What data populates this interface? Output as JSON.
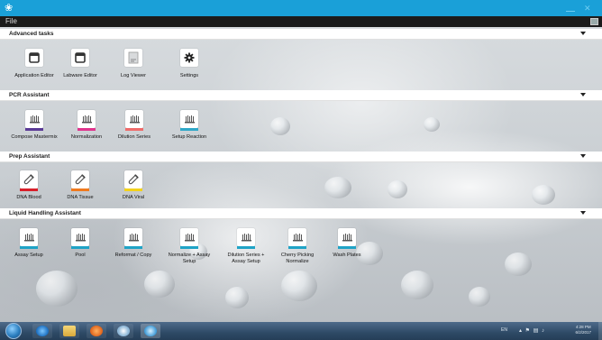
{
  "menu": {
    "file": "File"
  },
  "sections": [
    {
      "title": "Advanced tasks",
      "tiles": [
        {
          "label": "Application Editor",
          "icon": "window-icon",
          "bar": null
        },
        {
          "label": "Labware Editor",
          "icon": "window-icon",
          "bar": null
        },
        {
          "label": "Log Viewer",
          "icon": "log-icon",
          "bar": null
        },
        {
          "label": "Settings",
          "icon": "gear-icon",
          "bar": null
        }
      ]
    },
    {
      "title": "PCR Assistant",
      "tiles": [
        {
          "label": "Compose Mastermix",
          "icon": "plate-icon",
          "bar": "#5b3a96"
        },
        {
          "label": "Normalization",
          "icon": "plate-icon",
          "bar": "#e0348c"
        },
        {
          "label": "Dilution Series",
          "icon": "plate-icon",
          "bar": "#ef6a6a"
        },
        {
          "label": "Setup Reaction",
          "icon": "plate-icon",
          "bar": "#2fa8c8"
        }
      ]
    },
    {
      "title": "Prep Assistant",
      "tiles": [
        {
          "label": "DNA Blood",
          "icon": "tube-icon",
          "bar": "#d81f2a"
        },
        {
          "label": "DNA Tissue",
          "icon": "tube-icon",
          "bar": "#f07a1e"
        },
        {
          "label": "DNA Viral",
          "icon": "tube-icon",
          "bar": "#f3d21b"
        }
      ]
    },
    {
      "title": "Liquid Handling Assistant",
      "tiles": [
        {
          "label": "Assay Setup",
          "icon": "plate-icon",
          "bar": "#1fa3c6"
        },
        {
          "label": "Pool",
          "icon": "plate-icon",
          "bar": "#1fa3c6"
        },
        {
          "label": "Reformat / Copy",
          "icon": "plate-icon",
          "bar": "#1fa3c6"
        },
        {
          "label": "Normalize + Assay Setup",
          "icon": "plate-icon",
          "bar": "#1fa3c6"
        },
        {
          "label": "Dilution Series + Assay Setup",
          "icon": "plate-icon",
          "bar": "#1fa3c6"
        },
        {
          "label": "Cherry Picking Normalize",
          "icon": "plate-icon",
          "bar": "#1fa3c6"
        },
        {
          "label": "Wash Plates",
          "icon": "plate-icon",
          "bar": "#1fa3c6"
        }
      ]
    }
  ],
  "tray": {
    "lang": "EN",
    "time": "4:28 PM",
    "date": "6/2/2017"
  },
  "colors": {
    "titlebar": "#1aa0d8",
    "menubar": "#1b1b1b"
  }
}
